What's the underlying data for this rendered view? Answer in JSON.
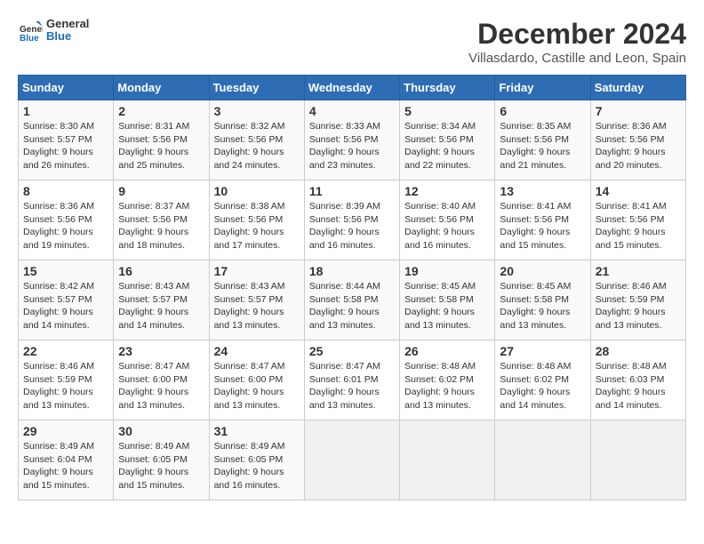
{
  "logo": {
    "text_general": "General",
    "text_blue": "Blue"
  },
  "title": "December 2024",
  "location": "Villasdardo, Castille and Leon, Spain",
  "weekdays": [
    "Sunday",
    "Monday",
    "Tuesday",
    "Wednesday",
    "Thursday",
    "Friday",
    "Saturday"
  ],
  "weeks": [
    [
      {
        "day": 1,
        "sunrise": "8:30 AM",
        "sunset": "5:57 PM",
        "daylight": "9 hours and 26 minutes."
      },
      {
        "day": 2,
        "sunrise": "8:31 AM",
        "sunset": "5:56 PM",
        "daylight": "9 hours and 25 minutes."
      },
      {
        "day": 3,
        "sunrise": "8:32 AM",
        "sunset": "5:56 PM",
        "daylight": "9 hours and 24 minutes."
      },
      {
        "day": 4,
        "sunrise": "8:33 AM",
        "sunset": "5:56 PM",
        "daylight": "9 hours and 23 minutes."
      },
      {
        "day": 5,
        "sunrise": "8:34 AM",
        "sunset": "5:56 PM",
        "daylight": "9 hours and 22 minutes."
      },
      {
        "day": 6,
        "sunrise": "8:35 AM",
        "sunset": "5:56 PM",
        "daylight": "9 hours and 21 minutes."
      },
      {
        "day": 7,
        "sunrise": "8:36 AM",
        "sunset": "5:56 PM",
        "daylight": "9 hours and 20 minutes."
      }
    ],
    [
      {
        "day": 8,
        "sunrise": "8:36 AM",
        "sunset": "5:56 PM",
        "daylight": "9 hours and 19 minutes."
      },
      {
        "day": 9,
        "sunrise": "8:37 AM",
        "sunset": "5:56 PM",
        "daylight": "9 hours and 18 minutes."
      },
      {
        "day": 10,
        "sunrise": "8:38 AM",
        "sunset": "5:56 PM",
        "daylight": "9 hours and 17 minutes."
      },
      {
        "day": 11,
        "sunrise": "8:39 AM",
        "sunset": "5:56 PM",
        "daylight": "9 hours and 16 minutes."
      },
      {
        "day": 12,
        "sunrise": "8:40 AM",
        "sunset": "5:56 PM",
        "daylight": "9 hours and 16 minutes."
      },
      {
        "day": 13,
        "sunrise": "8:41 AM",
        "sunset": "5:56 PM",
        "daylight": "9 hours and 15 minutes."
      },
      {
        "day": 14,
        "sunrise": "8:41 AM",
        "sunset": "5:56 PM",
        "daylight": "9 hours and 15 minutes."
      }
    ],
    [
      {
        "day": 15,
        "sunrise": "8:42 AM",
        "sunset": "5:57 PM",
        "daylight": "9 hours and 14 minutes."
      },
      {
        "day": 16,
        "sunrise": "8:43 AM",
        "sunset": "5:57 PM",
        "daylight": "9 hours and 14 minutes."
      },
      {
        "day": 17,
        "sunrise": "8:43 AM",
        "sunset": "5:57 PM",
        "daylight": "9 hours and 13 minutes."
      },
      {
        "day": 18,
        "sunrise": "8:44 AM",
        "sunset": "5:58 PM",
        "daylight": "9 hours and 13 minutes."
      },
      {
        "day": 19,
        "sunrise": "8:45 AM",
        "sunset": "5:58 PM",
        "daylight": "9 hours and 13 minutes."
      },
      {
        "day": 20,
        "sunrise": "8:45 AM",
        "sunset": "5:58 PM",
        "daylight": "9 hours and 13 minutes."
      },
      {
        "day": 21,
        "sunrise": "8:46 AM",
        "sunset": "5:59 PM",
        "daylight": "9 hours and 13 minutes."
      }
    ],
    [
      {
        "day": 22,
        "sunrise": "8:46 AM",
        "sunset": "5:59 PM",
        "daylight": "9 hours and 13 minutes."
      },
      {
        "day": 23,
        "sunrise": "8:47 AM",
        "sunset": "6:00 PM",
        "daylight": "9 hours and 13 minutes."
      },
      {
        "day": 24,
        "sunrise": "8:47 AM",
        "sunset": "6:00 PM",
        "daylight": "9 hours and 13 minutes."
      },
      {
        "day": 25,
        "sunrise": "8:47 AM",
        "sunset": "6:01 PM",
        "daylight": "9 hours and 13 minutes."
      },
      {
        "day": 26,
        "sunrise": "8:48 AM",
        "sunset": "6:02 PM",
        "daylight": "9 hours and 13 minutes."
      },
      {
        "day": 27,
        "sunrise": "8:48 AM",
        "sunset": "6:02 PM",
        "daylight": "9 hours and 14 minutes."
      },
      {
        "day": 28,
        "sunrise": "8:48 AM",
        "sunset": "6:03 PM",
        "daylight": "9 hours and 14 minutes."
      }
    ],
    [
      {
        "day": 29,
        "sunrise": "8:49 AM",
        "sunset": "6:04 PM",
        "daylight": "9 hours and 15 minutes."
      },
      {
        "day": 30,
        "sunrise": "8:49 AM",
        "sunset": "6:05 PM",
        "daylight": "9 hours and 15 minutes."
      },
      {
        "day": 31,
        "sunrise": "8:49 AM",
        "sunset": "6:05 PM",
        "daylight": "9 hours and 16 minutes."
      },
      null,
      null,
      null,
      null
    ]
  ]
}
